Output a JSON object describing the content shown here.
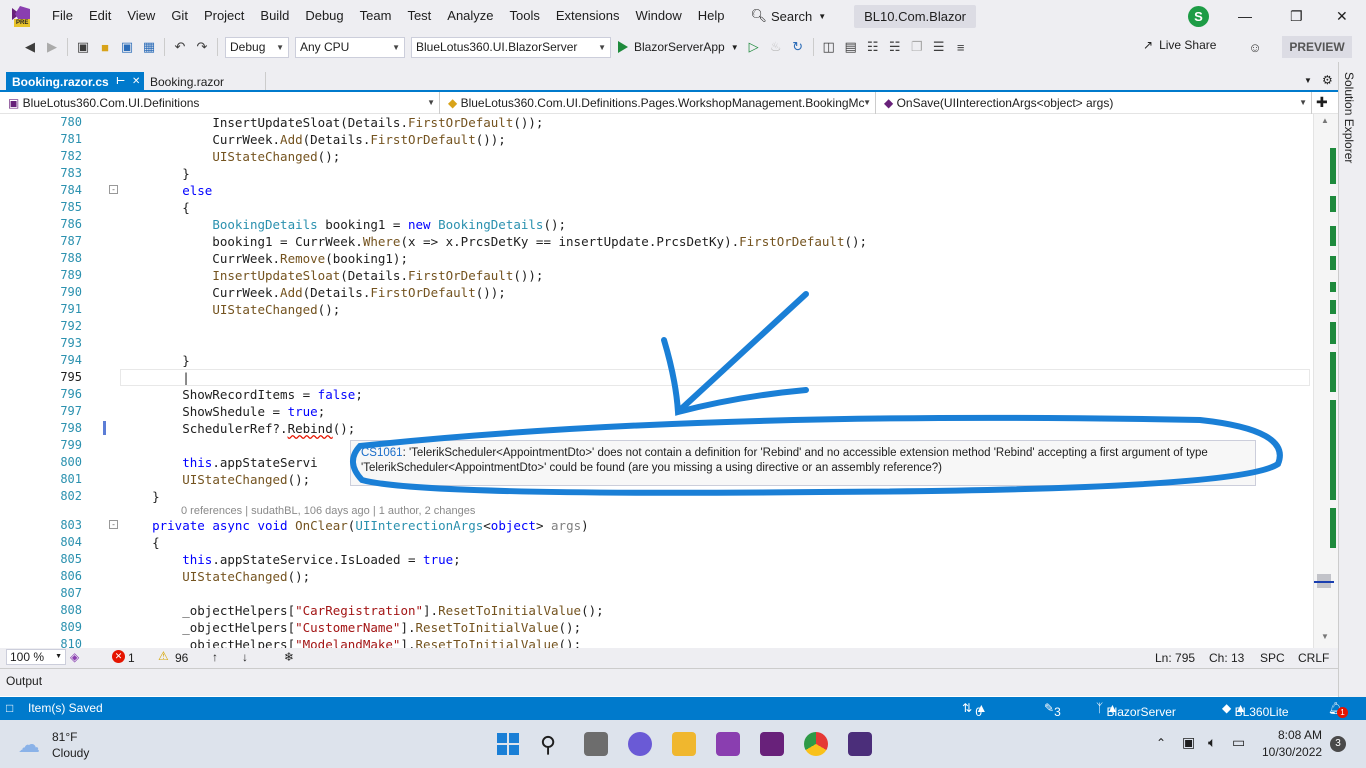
{
  "menu": {
    "items": [
      "File",
      "Edit",
      "View",
      "Git",
      "Project",
      "Build",
      "Debug",
      "Team",
      "Test",
      "Analyze",
      "Tools",
      "Extensions",
      "Window",
      "Help"
    ],
    "search_label": "Search",
    "solution_name": "BL10.Com.Blazor",
    "avatar_letter": "S",
    "logo_badge": "PRE"
  },
  "toolbar": {
    "config": "Debug",
    "platform": "Any CPU",
    "project": "BlueLotus360.UI.BlazorServer",
    "run_label": "BlazorServerApp",
    "live_share": "Live Share",
    "preview": "PREVIEW"
  },
  "tabs": [
    {
      "label": "Booking.razor.cs",
      "active": true
    },
    {
      "label": "Booking.razor",
      "active": false
    }
  ],
  "navbar": {
    "project": "BlueLotus360.Com.UI.Definitions",
    "type": "BlueLotus360.Com.UI.Definitions.Pages.WorkshopManagement.BookingMc",
    "member": "OnSave(UIInterectionArgs<object> args)"
  },
  "code": {
    "l780": "780",
    "l781": "781",
    "l782": "782",
    "l783": "783",
    "l784": "784",
    "l785": "785",
    "l786": "786",
    "l787": "787",
    "l788": "788",
    "l789": "789",
    "l790": "790",
    "l791": "791",
    "l792": "792",
    "l793": "793",
    "l794": "794",
    "l795": "795",
    "l796": "796",
    "l797": "797",
    "l798": "798",
    "l799": "799",
    "l800": "800",
    "l801": "801",
    "l802": "802",
    "l803": "803",
    "l804": "804",
    "l805": "805",
    "l806": "806",
    "l807": "807",
    "l808": "808",
    "l809": "809",
    "l810": "810",
    "codelens": "0 references | sudathBL, 106 days ago | 1 author, 2 changes"
  },
  "tooltip": {
    "code": "CS1061",
    "message": ": 'TelerikScheduler<AppointmentDto>' does not contain a definition for 'Rebind' and no accessible extension method 'Rebind' accepting a first argument of type 'TelerikScheduler<AppointmentDto>' could be found (are you missing a using directive or an assembly reference?)"
  },
  "edit_status": {
    "zoom": "100 %",
    "errors": "1",
    "warnings": "96",
    "ln": "Ln: 795",
    "ch": "Ch: 13",
    "mode": "SPC",
    "eol": "CRLF"
  },
  "output": {
    "label": "Output"
  },
  "rail": {
    "label": "Solution Explorer"
  },
  "statusbar": {
    "message": "Item(s) Saved",
    "changes": "0 / 0",
    "pencil_count": "3",
    "branch": "BlazorServer",
    "repo": "BL360Lite",
    "notifications": "1"
  },
  "taskbar": {
    "temp": "81°F",
    "weather": "Cloudy",
    "time": "8:08 AM",
    "date": "10/30/2022",
    "badge": "3"
  }
}
